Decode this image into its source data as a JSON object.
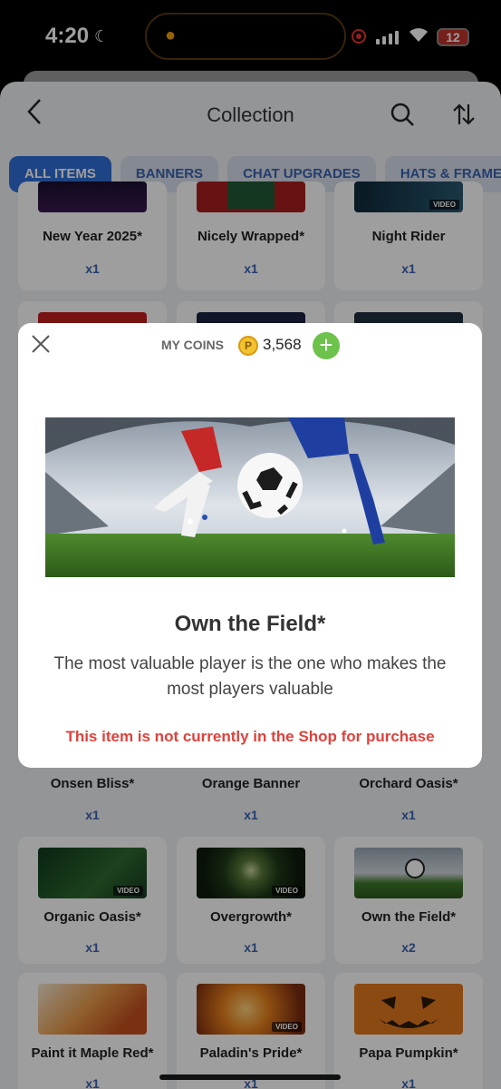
{
  "status_bar": {
    "time": "4:20",
    "battery": "12"
  },
  "header": {
    "title": "Collection"
  },
  "tabs": [
    "ALL ITEMS",
    "BANNERS",
    "CHAT UPGRADES",
    "HATS & FRAMES"
  ],
  "items": [
    {
      "name": "New Year 2025*",
      "qty": "x1",
      "video": false
    },
    {
      "name": "Nicely Wrapped*",
      "qty": "x1",
      "video": false
    },
    {
      "name": "Night Rider",
      "qty": "x1",
      "video": true
    },
    {
      "name": "Onsen Bliss*",
      "qty": "x1",
      "video": false
    },
    {
      "name": "Orange Banner",
      "qty": "x1",
      "video": false
    },
    {
      "name": "Orchard Oasis*",
      "qty": "x1",
      "video": false
    },
    {
      "name": "Organic Oasis*",
      "qty": "x1",
      "video": true
    },
    {
      "name": "Overgrowth*",
      "qty": "x1",
      "video": true
    },
    {
      "name": "Own the Field*",
      "qty": "x2",
      "video": false
    },
    {
      "name": "Paint it Maple Red*",
      "qty": "x1",
      "video": false
    },
    {
      "name": "Paladin's Pride*",
      "qty": "x1",
      "video": true
    },
    {
      "name": "Papa Pumpkin*",
      "qty": "x1",
      "video": false
    }
  ],
  "video_label": "VIDEO",
  "modal": {
    "coins_label": "MY COINS",
    "coin_symbol": "P",
    "coins": "3,568",
    "add_symbol": "+",
    "title": "Own the Field*",
    "description": "The most valuable player is the one who makes the most players valuable",
    "note": "This item is not currently in the Shop for purchase"
  },
  "colors": {
    "accent": "#2f6fd6",
    "warning": "#e0413b",
    "coin_add": "#6cc24a"
  }
}
